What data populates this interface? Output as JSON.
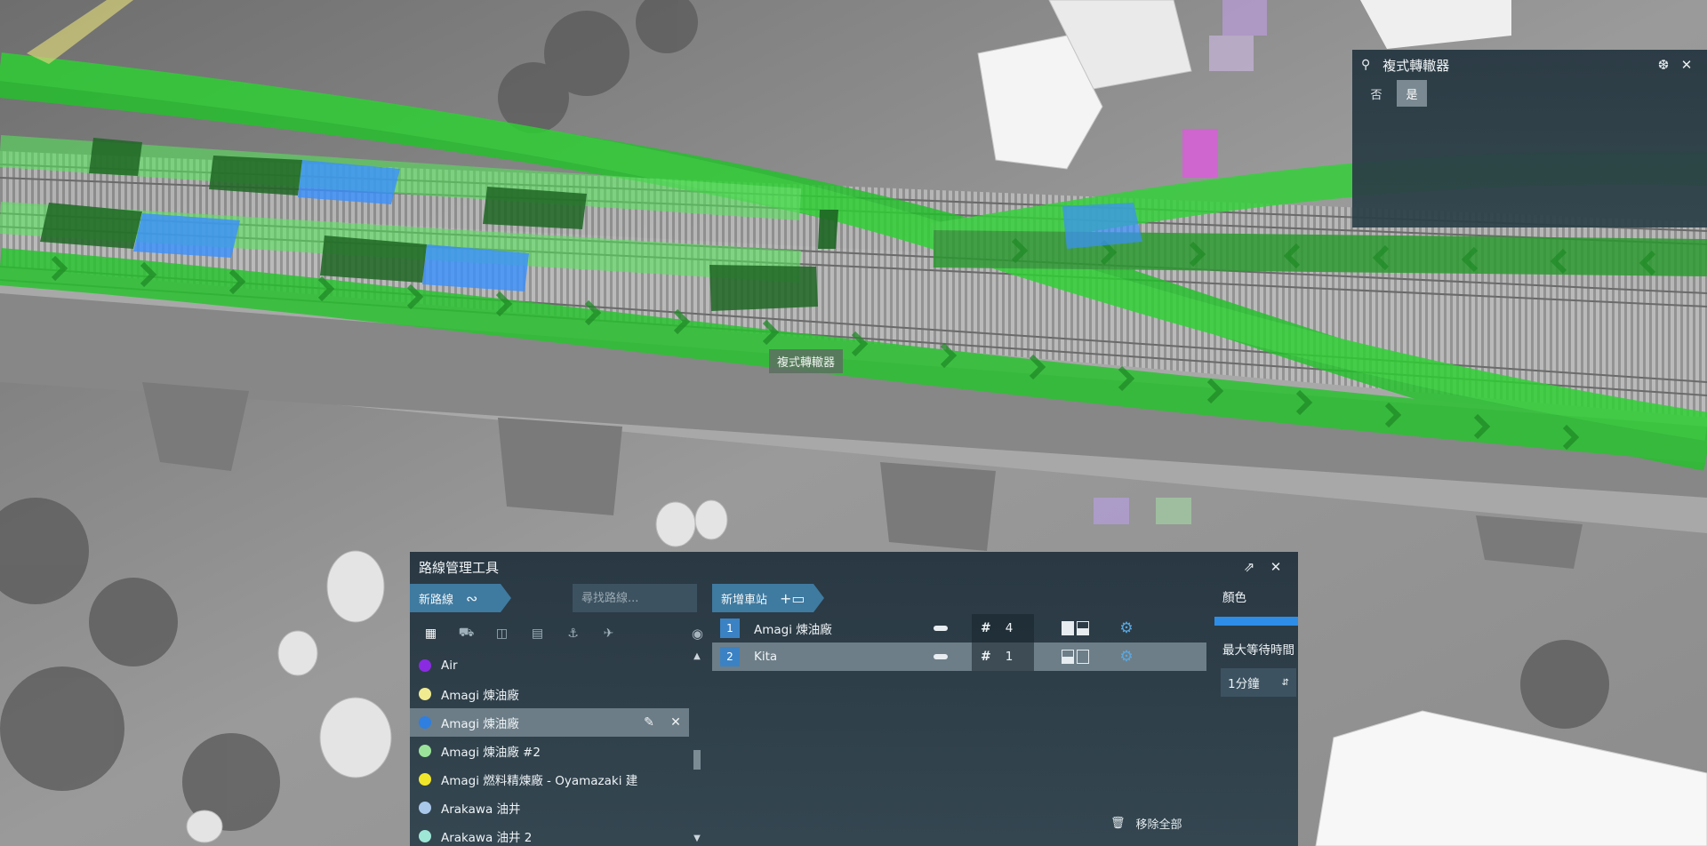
{
  "scene": {
    "label": "複式轉轍器"
  },
  "signal_panel": {
    "title": "複式轉轍器",
    "icons": {
      "location": "location-pin-icon",
      "pin": "pin-icon",
      "close": "close-icon"
    },
    "options": [
      {
        "label": "否",
        "selected": false
      },
      {
        "label": "是",
        "selected": true
      }
    ]
  },
  "route_window": {
    "title": "路線管理工具",
    "new_route_label": "新路線",
    "search_placeholder": "尋找路線...",
    "new_station_label": "新增車站",
    "filters": [
      {
        "icon": "grid-icon",
        "selected": true
      },
      {
        "icon": "truck-icon",
        "selected": false
      },
      {
        "icon": "bus-icon",
        "selected": false
      },
      {
        "icon": "train-icon",
        "selected": false
      },
      {
        "icon": "ship-icon",
        "selected": false
      },
      {
        "icon": "plane-icon",
        "selected": false
      }
    ],
    "routes": [
      {
        "name": "Air",
        "color": "#8a2be2",
        "selected": false
      },
      {
        "name": "Amagi 煉油廠",
        "color": "#f0eb90",
        "selected": false
      },
      {
        "name": "Amagi 煉油廠",
        "color": "#2e7fe0",
        "selected": true
      },
      {
        "name": "Amagi 煉油廠 #2",
        "color": "#9be39a",
        "selected": false
      },
      {
        "name": "Amagi 燃料精煉廠 - Oyamazaki 建",
        "color": "#f2e62b",
        "selected": false
      },
      {
        "name": "Arakawa 油井",
        "color": "#a9c8ea",
        "selected": false
      },
      {
        "name": "Arakawa 油井 2",
        "color": "#9ee6d6",
        "selected": false
      }
    ],
    "stations": [
      {
        "num": "1",
        "name": "Amagi 煉油廠",
        "count": "4",
        "selected": false
      },
      {
        "num": "2",
        "name": "Kita",
        "count": "1",
        "selected": true
      }
    ],
    "color_label": "顏色",
    "route_color": "#2e8de6",
    "max_wait_label": "最大等待時間",
    "max_wait_value": "1分鐘",
    "remove_all_label": "移除全部"
  }
}
